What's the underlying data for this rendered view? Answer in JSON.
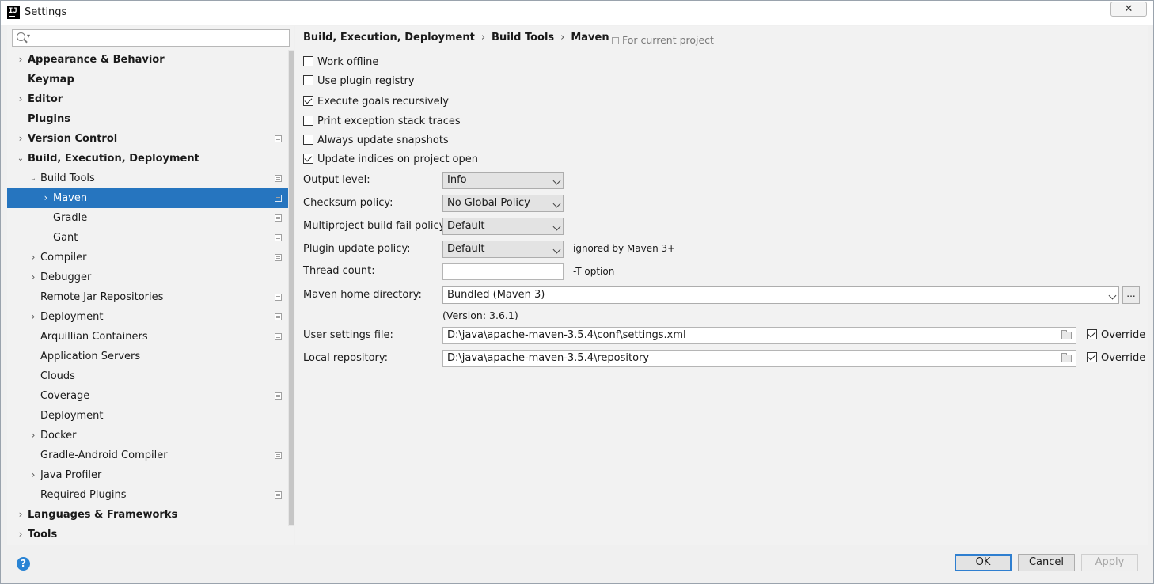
{
  "window": {
    "title": "Settings",
    "close_glyph": "✕",
    "app_icon": "IJ"
  },
  "search": {
    "value": "",
    "placeholder": ""
  },
  "tree": [
    {
      "label": "Appearance & Behavior",
      "level": 0,
      "expand": "collapsed",
      "bold": true,
      "proj": false,
      "selected": false
    },
    {
      "label": "Keymap",
      "level": 0,
      "expand": "none",
      "bold": true,
      "proj": false,
      "selected": false
    },
    {
      "label": "Editor",
      "level": 0,
      "expand": "collapsed",
      "bold": true,
      "proj": false,
      "selected": false
    },
    {
      "label": "Plugins",
      "level": 0,
      "expand": "none",
      "bold": true,
      "proj": false,
      "selected": false
    },
    {
      "label": "Version Control",
      "level": 0,
      "expand": "collapsed",
      "bold": true,
      "proj": true,
      "selected": false
    },
    {
      "label": "Build, Execution, Deployment",
      "level": 0,
      "expand": "expanded",
      "bold": true,
      "proj": false,
      "selected": false
    },
    {
      "label": "Build Tools",
      "level": 1,
      "expand": "expanded",
      "bold": false,
      "proj": true,
      "selected": false
    },
    {
      "label": "Maven",
      "level": 2,
      "expand": "collapsed",
      "bold": false,
      "proj": true,
      "selected": true
    },
    {
      "label": "Gradle",
      "level": 2,
      "expand": "none",
      "bold": false,
      "proj": true,
      "selected": false
    },
    {
      "label": "Gant",
      "level": 2,
      "expand": "none",
      "bold": false,
      "proj": true,
      "selected": false
    },
    {
      "label": "Compiler",
      "level": 1,
      "expand": "collapsed",
      "bold": false,
      "proj": true,
      "selected": false
    },
    {
      "label": "Debugger",
      "level": 1,
      "expand": "collapsed",
      "bold": false,
      "proj": false,
      "selected": false
    },
    {
      "label": "Remote Jar Repositories",
      "level": 1,
      "expand": "none",
      "bold": false,
      "proj": true,
      "selected": false
    },
    {
      "label": "Deployment",
      "level": 1,
      "expand": "collapsed",
      "bold": false,
      "proj": true,
      "selected": false
    },
    {
      "label": "Arquillian Containers",
      "level": 1,
      "expand": "none",
      "bold": false,
      "proj": true,
      "selected": false
    },
    {
      "label": "Application Servers",
      "level": 1,
      "expand": "none",
      "bold": false,
      "proj": false,
      "selected": false
    },
    {
      "label": "Clouds",
      "level": 1,
      "expand": "none",
      "bold": false,
      "proj": false,
      "selected": false
    },
    {
      "label": "Coverage",
      "level": 1,
      "expand": "none",
      "bold": false,
      "proj": true,
      "selected": false
    },
    {
      "label": "Deployment",
      "level": 1,
      "expand": "none",
      "bold": false,
      "proj": false,
      "selected": false
    },
    {
      "label": "Docker",
      "level": 1,
      "expand": "collapsed",
      "bold": false,
      "proj": false,
      "selected": false
    },
    {
      "label": "Gradle-Android Compiler",
      "level": 1,
      "expand": "none",
      "bold": false,
      "proj": true,
      "selected": false
    },
    {
      "label": "Java Profiler",
      "level": 1,
      "expand": "collapsed",
      "bold": false,
      "proj": false,
      "selected": false
    },
    {
      "label": "Required Plugins",
      "level": 1,
      "expand": "none",
      "bold": false,
      "proj": true,
      "selected": false
    },
    {
      "label": "Languages & Frameworks",
      "level": 0,
      "expand": "collapsed",
      "bold": true,
      "proj": false,
      "selected": false
    },
    {
      "label": "Tools",
      "level": 0,
      "expand": "collapsed",
      "bold": true,
      "proj": false,
      "selected": false
    }
  ],
  "breadcrumb": {
    "items": [
      "Build, Execution, Deployment",
      "Build Tools",
      "Maven"
    ],
    "separator": "›"
  },
  "for_current_project": "For current project",
  "checkboxes": [
    {
      "label": "Work offline",
      "checked": false
    },
    {
      "label": "Use plugin registry",
      "checked": false
    },
    {
      "label": "Execute goals recursively",
      "checked": true
    },
    {
      "label": "Print exception stack traces",
      "checked": false
    },
    {
      "label": "Always update snapshots",
      "checked": false
    },
    {
      "label": "Update indices on project open",
      "checked": true
    }
  ],
  "fields": {
    "output_level": {
      "label": "Output level:",
      "value": "Info"
    },
    "checksum_policy": {
      "label": "Checksum policy:",
      "value": "No Global Policy"
    },
    "multiproject_fail": {
      "label": "Multiproject build fail policy:",
      "value": "Default"
    },
    "plugin_update": {
      "label": "Plugin update policy:",
      "value": "Default",
      "note": "ignored by Maven 3+"
    },
    "thread_count": {
      "label": "Thread count:",
      "value": "",
      "note": "-T option"
    },
    "maven_home": {
      "label": "Maven home directory:",
      "value": "Bundled (Maven 3)",
      "browse": "...",
      "version": "(Version: 3.6.1)"
    },
    "user_settings": {
      "label": "User settings file:",
      "value": "D:\\java\\apache-maven-3.5.4\\conf\\settings.xml",
      "override_label": "Override",
      "override": true
    },
    "local_repo": {
      "label": "Local repository:",
      "value": "D:\\java\\apache-maven-3.5.4\\repository",
      "override_label": "Override",
      "override": true
    }
  },
  "footer": {
    "help": "?",
    "ok": "OK",
    "cancel": "Cancel",
    "apply": "Apply"
  },
  "colors": {
    "selection": "#2675bf",
    "primary_border": "#2f7fd0",
    "help": "#2a84d4"
  }
}
